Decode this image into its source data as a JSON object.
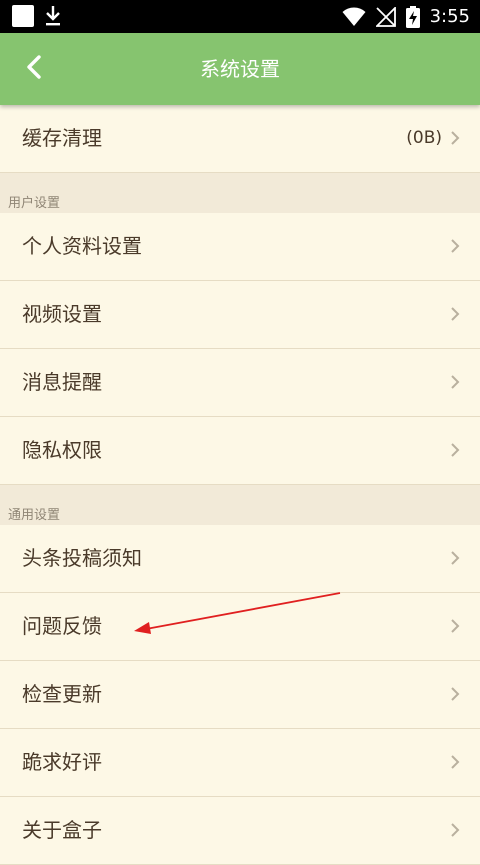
{
  "status_bar": {
    "time": "3:55"
  },
  "header": {
    "title": "系统设置"
  },
  "cache_row": {
    "label": "缓存清理",
    "value": "(0B)"
  },
  "sections": {
    "user": {
      "header": "用户设置",
      "items": [
        "个人资料设置",
        "视频设置",
        "消息提醒",
        "隐私权限"
      ]
    },
    "general": {
      "header": "通用设置",
      "items": [
        "头条投稿须知",
        "问题反馈",
        "检查更新",
        "跪求好评",
        "关于盒子"
      ]
    }
  },
  "colors": {
    "app_bar": "#86c46f",
    "row_bg": "#fdf8e6",
    "page_bg": "#f2ead8",
    "annotation_arrow": "#e02020"
  },
  "icons": {
    "back": "chevron-left-icon",
    "row_arrow": "chevron-right-icon"
  }
}
